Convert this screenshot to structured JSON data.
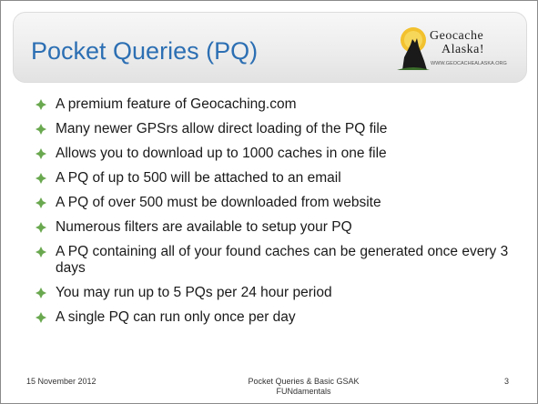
{
  "slide": {
    "title": "Pocket Queries (PQ)",
    "logo": {
      "line1": "Geocache",
      "line2": "Alaska!",
      "url": "WWW.GEOCACHEALASKA.ORG"
    },
    "bullets": [
      "A premium feature of Geocaching.com",
      "Many newer GPSrs allow direct loading of the PQ file",
      "Allows you to download up to 1000 caches in one file",
      "A PQ of up to 500 will be attached to an email",
      "A PQ of over 500 must be downloaded from website",
      "Numerous filters are available to setup your PQ",
      "A PQ containing all of your found caches can be generated once every 3 days",
      "You may run up to 5 PQs per 24 hour period",
      "A single PQ can run only once per day"
    ],
    "bullet_icon": "four-petal-diamond-icon",
    "footer": {
      "date": "15 November  2012",
      "center": "Pocket Queries & Basic GSAK FUNdamentals",
      "page": "3"
    }
  },
  "colors": {
    "title": "#2c6fb3",
    "bullet": "#6aa84f",
    "text": "#1a1a1a"
  }
}
